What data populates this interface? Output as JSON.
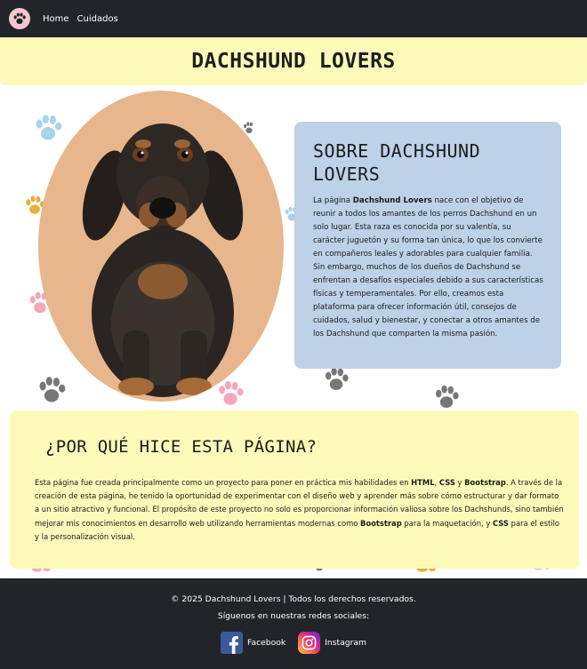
{
  "nav": {
    "logo_icon": "paw-icon",
    "links": [
      "Home",
      "Cuidados"
    ]
  },
  "header": {
    "title": "DACHSHUND LOVERS"
  },
  "hero": {
    "image_alt_icon": "dachshund-photo",
    "portrait_bg": "#e7b68c"
  },
  "about": {
    "title": "SOBRE DACHSHUND LOVERS",
    "p_pre": "La página ",
    "p_bold": "Dachshund Lovers",
    "p_post": " nace con el objetivo de reunir a todos los amantes de los perros Dachshund en un solo lugar. Esta raza es conocida por su valentía, su carácter juguetón y su forma tan única, lo que los convierte en compañeros leales y adorables para cualquier familia. Sin embargo, muchos de los dueños de Dachshund se enfrentan a desafíos especiales debido a sus características físicas y temperamentales. Por ello, creamos esta plataforma para ofrecer información útil, consejos de cuidados, salud y bienestar, y conectar a otros amantes de los Dachshund que comparten la misma pasión.",
    "bg": "#bdd1e7"
  },
  "why": {
    "title": "¿POR QUÉ HICE ESTA PÁGINA?",
    "t1": "Esta página fue creada principalmente como un proyecto para poner en práctica mis habilidades en ",
    "b1": "HTML",
    "t2": ", ",
    "b2": "CSS",
    "t3": " y ",
    "b3": "Bootstrap",
    "t4": ". A través de la creación de esta página, he tenido la oportunidad de experimentar con el diseño web y aprender más sobre cómo estructurar y dar formato a un sitio atractivo y funcional. El propósito de este proyecto no solo es proporcionar información valiosa sobre los Dachshunds, sino también mejorar mis conocimientos en desarrollo web utilizando herramientas modernas como ",
    "b4": "Bootstrap",
    "t5": " para la maquetación, y ",
    "b5": "CSS",
    "t6": " para el estilo y la personalización visual.",
    "bg": "#fdfab9"
  },
  "footer": {
    "copyright": "© 2025 Dachshund Lovers | Todos los derechos reservados.",
    "follow": "Síguenos en nuestras redes sociales:",
    "facebook_label": "Facebook",
    "instagram_label": "Instagram",
    "facebook_icon": "facebook-icon",
    "instagram_icon": "instagram-icon"
  },
  "colors": {
    "navbar": "#212529",
    "header_band": "#fdfab9",
    "paw_blue": "#a9d3ec",
    "paw_pink": "#f7a7b8",
    "paw_gold": "#e3b23c",
    "paw_gray": "#777777"
  }
}
